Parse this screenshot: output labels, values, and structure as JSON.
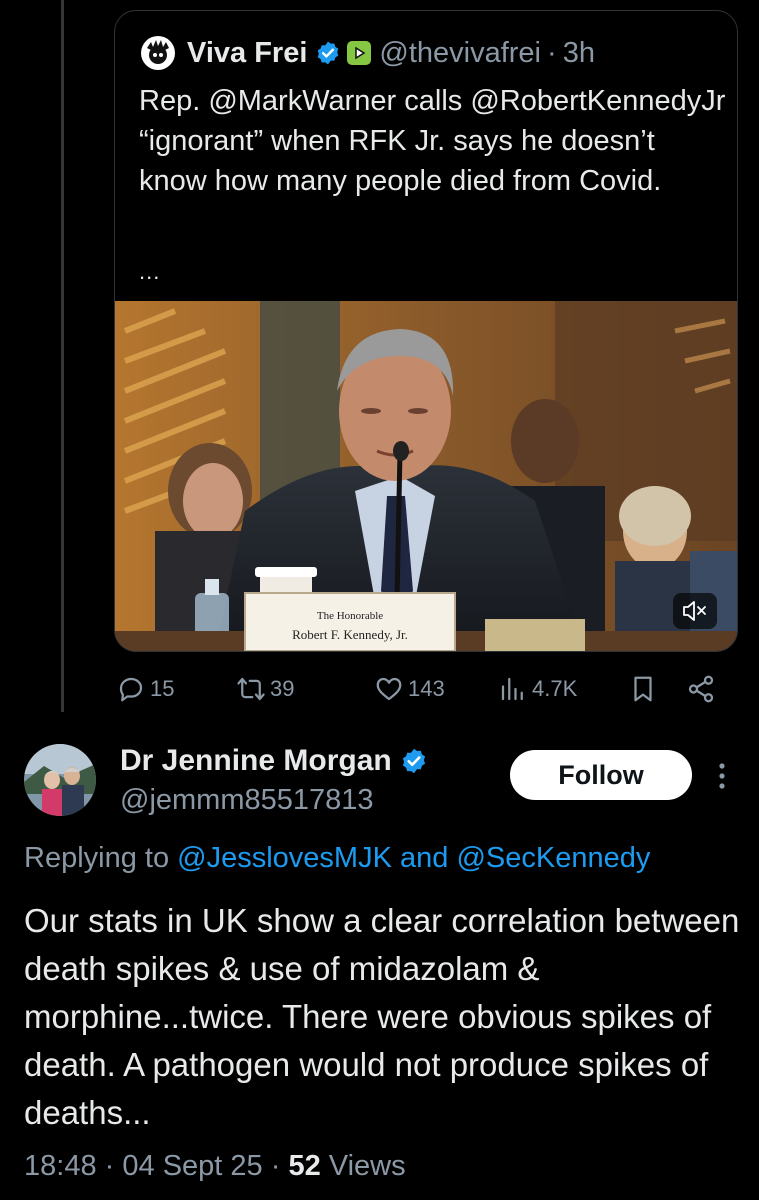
{
  "quoted_post": {
    "author_name": "Viva Frei",
    "author_handle": "@thevivafrei",
    "separator": "·",
    "time": "3h",
    "text": "Rep. @MarkWarner calls @RobertKennedyJr “ignorant” when RFK Jr. says he doesn’t know how many people died from Covid.",
    "more": "...",
    "video": {
      "nameplate_line1": "The Honorable",
      "nameplate_line2": "Robert F. Kennedy, Jr."
    }
  },
  "actions": {
    "replies": "15",
    "reposts": "39",
    "likes": "143",
    "views": "4.7K"
  },
  "reply": {
    "author_name": "Dr Jennine Morgan",
    "author_handle": "@jemmm85517813",
    "follow_label": "Follow",
    "replying_prefix": "Replying to",
    "replying_to_1": "@JesslovesMJK",
    "replying_and": "and",
    "replying_to_2": "@SecKennedy",
    "text": "Our stats in UK show a clear correlation between death spikes & use of midazolam & morphine...twice. There were obvious spikes of death. A pathogen would not produce spikes of deaths...",
    "time": "18:48",
    "separator": "·",
    "date": "04 Sept 25",
    "views_count": "52",
    "views_label": "Views"
  },
  "colors": {
    "background": "#000000",
    "text_primary": "#e7e9ea",
    "text_secondary": "#8b98a5",
    "link": "#1d9bf0",
    "verified_badge": "#1d9bf0"
  },
  "icons": [
    "verified-badge-icon",
    "rumble-icon",
    "mute-icon",
    "reply-icon",
    "repost-icon",
    "like-icon",
    "views-icon",
    "bookmark-icon",
    "share-icon",
    "more-options-icon"
  ]
}
